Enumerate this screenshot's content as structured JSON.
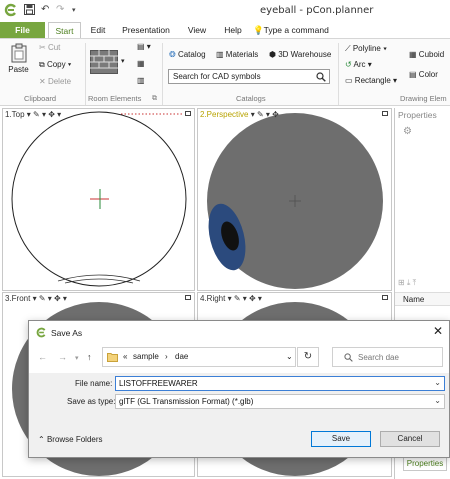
{
  "window": {
    "title": "eyeball - pCon.planner"
  },
  "tabs": [
    {
      "label": "File"
    },
    {
      "label": "Start"
    },
    {
      "label": "Edit"
    },
    {
      "label": "Presentation"
    },
    {
      "label": "View"
    },
    {
      "label": "Help"
    },
    {
      "label": "Type a command"
    }
  ],
  "ribbon": {
    "clipboard": {
      "paste": "Paste",
      "cut": "Cut",
      "copy": "Copy",
      "delete": "Delete",
      "group_label": "Clipboard"
    },
    "room_elements": {
      "group_label": "Room Elements"
    },
    "catalogs": {
      "catalog": "Catalog",
      "materials": "Materials",
      "warehouse": "3D Warehouse",
      "search_value": "Search for CAD symbols",
      "group_label": "Catalogs"
    },
    "drawing": {
      "polyline": "Polyline",
      "arc": "Arc",
      "rectangle": "Rectangle",
      "cuboid": "Cuboid",
      "color": "Color",
      "group_label": "Drawing Elem"
    }
  },
  "viewports": [
    {
      "label": "1.Top"
    },
    {
      "label": "2.Perspective"
    },
    {
      "label": "3.Front"
    },
    {
      "label": "4.Right"
    }
  ],
  "properties": {
    "title": "Properties",
    "name_col": "Name",
    "tab_label": "Properties"
  },
  "dialog": {
    "title": "Save As",
    "path": [
      "«",
      "sample",
      "›",
      "dae"
    ],
    "search_placeholder": "Search dae",
    "file_name_label": "File name:",
    "file_name_value": "LISTOFFREEWARER",
    "save_type_label": "Save as type:",
    "save_type_value": "glTF (GL Transmission Format) (*.glb)",
    "browse_folders": "Browse Folders",
    "save": "Save",
    "cancel": "Cancel"
  },
  "colors": {
    "accent_green": "#78a640",
    "active_tab_text": "#4c7f1e",
    "sphere_gray": "#6e6e6e",
    "iris_blue": "#2b4a7d",
    "focus_blue": "#0078d7"
  }
}
